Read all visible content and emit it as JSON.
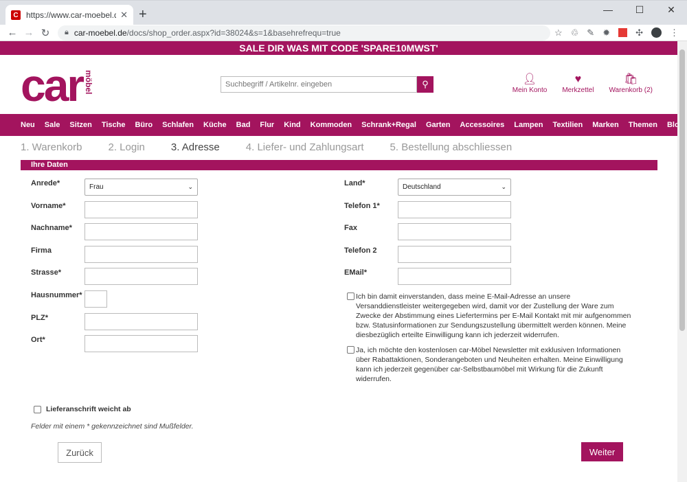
{
  "browser": {
    "tab_title": "https://www.car-moebel.de/docs",
    "url_host": "car-moebel.de",
    "url_path": "/docs/shop_order.aspx?id=38024&s=1&basehrefrequ=true"
  },
  "promo": "SALE DIR WAS MIT CODE 'SPARE10MWST'",
  "logo": {
    "word": "car",
    "sub": "möbel"
  },
  "search": {
    "placeholder": "Suchbegriff / Artikelnr. eingeben"
  },
  "header_icons": [
    {
      "label": "Mein Konto",
      "icon": "user-icon"
    },
    {
      "label": "Merkzettel",
      "icon": "heart-icon"
    },
    {
      "label": "Warenkorb (2)",
      "icon": "bag-icon"
    }
  ],
  "nav": [
    "Neu",
    "Sale",
    "Sitzen",
    "Tische",
    "Büro",
    "Schlafen",
    "Küche",
    "Bad",
    "Flur",
    "Kind",
    "Kommoden",
    "Schrank+Regal",
    "Garten",
    "Accessoires",
    "Lampen",
    "Textilien",
    "Marken",
    "Themen",
    "Blog"
  ],
  "steps": [
    "1. Warenkorb",
    "2. Login",
    "3. Adresse",
    "4. Liefer- und Zahlungsart",
    "5. Bestellung abschliessen"
  ],
  "section_title": "Ihre Daten",
  "left_fields": [
    {
      "label": "Anrede*",
      "type": "select",
      "value": "Frau"
    },
    {
      "label": "Vorname*"
    },
    {
      "label": "Nachname*"
    },
    {
      "label": "Firma"
    },
    {
      "label": "Strasse*"
    },
    {
      "label": "Hausnummer*"
    },
    {
      "label": "PLZ*"
    },
    {
      "label": "Ort*"
    }
  ],
  "right_fields": [
    {
      "label": "Land*",
      "type": "select",
      "value": "Deutschland"
    },
    {
      "label": "Telefon 1*"
    },
    {
      "label": "Fax"
    },
    {
      "label": "Telefon 2"
    },
    {
      "label": "EMail*"
    }
  ],
  "consent1": "Ich bin damit einverstanden, dass meine E-Mail-Adresse an unsere Versanddienstleister weitergegeben wird, damit vor der Zustellung der Ware zum Zwecke der Abstimmung eines Liefertermins per E-Mail Kontakt mit mir aufgenommen bzw. Statusinformationen zur Sendungszustellung übermittelt werden können. Meine diesbezüglich erteilte Einwilligung kann ich jederzeit widerrufen.",
  "consent2": "Ja, ich möchte den kostenlosen car-Möbel Newsletter mit exklusiven Informationen über Rabattaktionen, Sonderangeboten und Neuheiten erhalten. Meine Einwilligung kann ich jederzeit gegenüber car-Selbstbaumöbel mit Wirkung für die Zukunft widerrufen.",
  "liefer_label": "Lieferanschrift weicht ab",
  "note": "Felder mit einem * gekennzeichnet sind Mußfelder.",
  "buttons": {
    "back": "Zurück",
    "next": "Weiter"
  },
  "colors": {
    "brand": "#a3145e"
  }
}
